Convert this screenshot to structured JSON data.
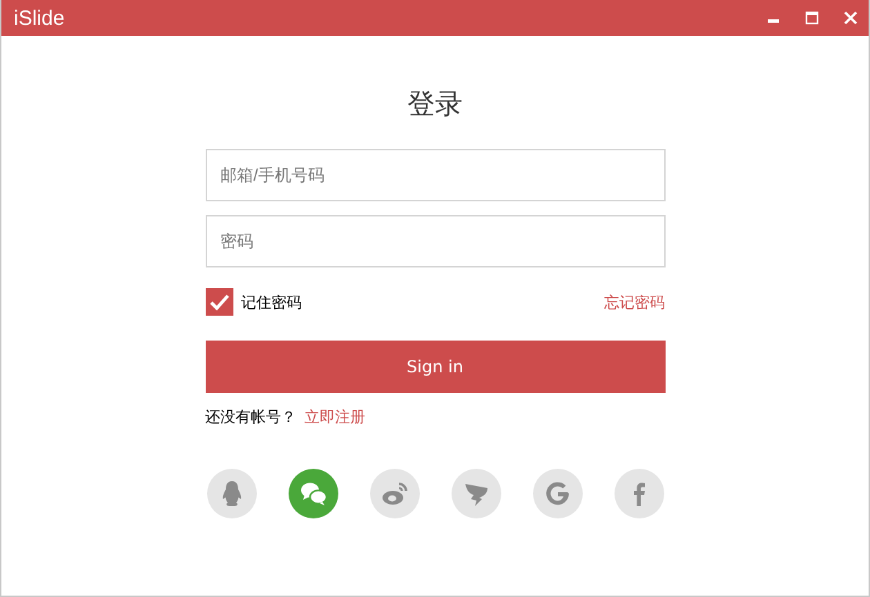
{
  "window": {
    "title": "iSlide"
  },
  "heading": "登录",
  "fields": [
    {
      "placeholder": "邮箱/手机号码"
    },
    {
      "placeholder": "密码"
    }
  ],
  "remember": {
    "label": "记住密码",
    "checked": true
  },
  "forgot_link": "忘记密码",
  "sign_in_button": "Sign in",
  "register": {
    "prompt": "还没有帐号？",
    "link": "立即注册"
  },
  "social_logins": [
    {
      "kind": "qq",
      "selected": false
    },
    {
      "kind": "wechat",
      "selected": true
    },
    {
      "kind": "weibo",
      "selected": false
    },
    {
      "kind": "dingtalk",
      "selected": false
    },
    {
      "kind": "google",
      "selected": false
    },
    {
      "kind": "facebook",
      "selected": false
    }
  ]
}
